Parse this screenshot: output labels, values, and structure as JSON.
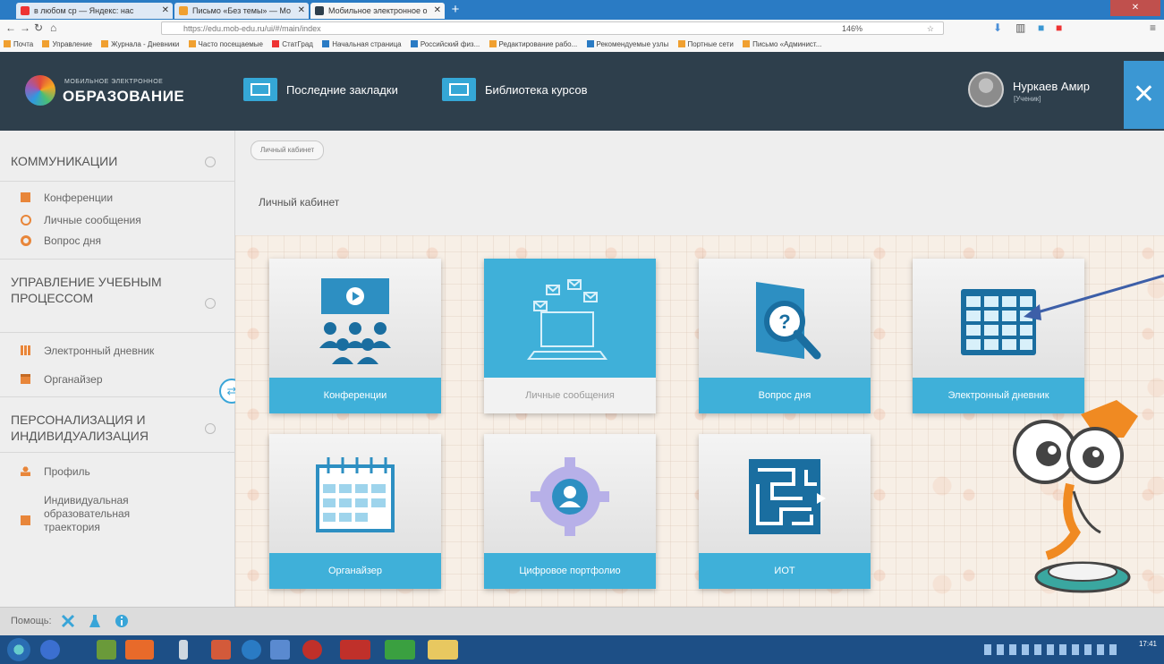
{
  "browser": {
    "tabs": [
      {
        "label": "в любом ср — Яндекс: нас",
        "icon": "yandex-tab-icon"
      },
      {
        "label": "Письмо «Без темы» — Мо",
        "icon": "mail-tab-icon"
      },
      {
        "label": "Мобильное электронное о",
        "icon": "site-tab-icon"
      }
    ],
    "url": "https://edu.mob-edu.ru/ui/#/main/index",
    "zoom": "146%",
    "bookmarks": [
      "Почта",
      "Управление",
      "Журнала - Дневники",
      "Часто посещаемые",
      "СтатГрад",
      "Начальная страница",
      "Российский физ...",
      "Редактирование рабо...",
      "Рекомендуемые узлы",
      "Портные сети",
      "Письмо «Админист..."
    ]
  },
  "header": {
    "logo_small": "МОБИЛЬНОЕ ЭЛЕКТРОННОЕ",
    "logo_big": "ОБРАЗОВАНИЕ",
    "nav": [
      {
        "label": "Последние закладки",
        "icon": "bookmarks-icon"
      },
      {
        "label": "Библиотека курсов",
        "icon": "course-library-icon"
      }
    ],
    "user_name": "Нуркаев Амир",
    "user_role": "[Ученик]",
    "close_symbol": "✕"
  },
  "sidebar": {
    "sections": [
      {
        "title": "КОММУНИКАЦИИ",
        "items": [
          {
            "label": "Конференции",
            "icon": "conference-icon",
            "color": "#e8863a"
          },
          {
            "label": "Личные сообщения",
            "icon": "messages-icon",
            "color": "#e8863a"
          },
          {
            "label": "Вопрос дня",
            "icon": "search-question-icon",
            "color": "#e8863a"
          }
        ]
      },
      {
        "title": "УПРАВЛЕНИЕ УЧЕБНЫМ ПРОЦЕССОМ",
        "items": [
          {
            "label": "Электронный дневник",
            "icon": "diary-icon",
            "color": "#e8863a"
          },
          {
            "label": "Органайзер",
            "icon": "calendar-icon",
            "color": "#e8863a"
          }
        ]
      },
      {
        "title": "ПЕРСОНАЛИЗАЦИЯ И ИНДИВИДУАЛИЗАЦИЯ",
        "items": [
          {
            "label": "Профиль",
            "icon": "profile-icon",
            "color": "#e8863a"
          },
          {
            "label": "Индивидуальная образовательная траектория",
            "icon": "trajectory-icon",
            "color": "#e8863a"
          }
        ]
      }
    ]
  },
  "main": {
    "breadcrumb": "Личный кабинет",
    "title": "Личный кабинет",
    "tiles": [
      {
        "label": "Конференции",
        "icon": "conference-tile-icon",
        "active": false
      },
      {
        "label": "Личные сообщения",
        "icon": "messages-tile-icon",
        "active": true
      },
      {
        "label": "Вопрос дня",
        "icon": "question-tile-icon",
        "active": false
      },
      {
        "label": "Электронный дневник",
        "icon": "diary-tile-icon",
        "active": false
      },
      {
        "label": "Органайзер",
        "icon": "calendar-tile-icon",
        "active": false
      },
      {
        "label": "Цифровое портфолио",
        "icon": "portfolio-tile-icon",
        "active": false
      },
      {
        "label": "ИОТ",
        "icon": "maze-tile-icon",
        "active": false
      }
    ]
  },
  "footer": {
    "help_label": "Помощь:",
    "help_icons": [
      "tools-icon",
      "flask-icon",
      "info-icon"
    ]
  },
  "taskbar": {
    "clock": "17:41"
  },
  "colors": {
    "header_bg": "#2e3f4c",
    "accent": "#3fb0d9",
    "sidebar_icon": "#e8863a",
    "close_bg": "#3b97d3"
  }
}
